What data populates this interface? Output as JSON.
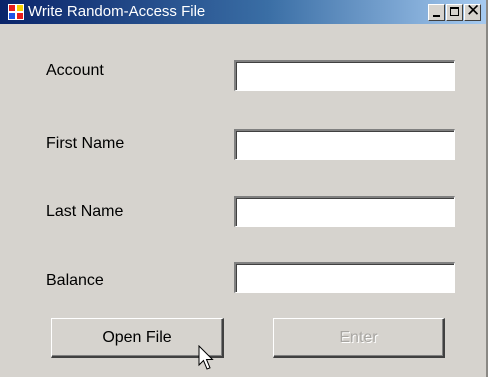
{
  "window": {
    "title": "Write Random-Access File"
  },
  "form": {
    "fields": [
      {
        "label": "Account",
        "value": "",
        "placeholder": ""
      },
      {
        "label": "First Name",
        "value": "",
        "placeholder": ""
      },
      {
        "label": "Last Name",
        "value": "",
        "placeholder": ""
      },
      {
        "label": "Balance",
        "value": "",
        "placeholder": ""
      }
    ]
  },
  "buttons": {
    "open_file": "Open File",
    "enter": "Enter",
    "enter_enabled": false
  },
  "icons": {
    "app": "application-icon",
    "cursor": "mouse-pointer-icon"
  }
}
